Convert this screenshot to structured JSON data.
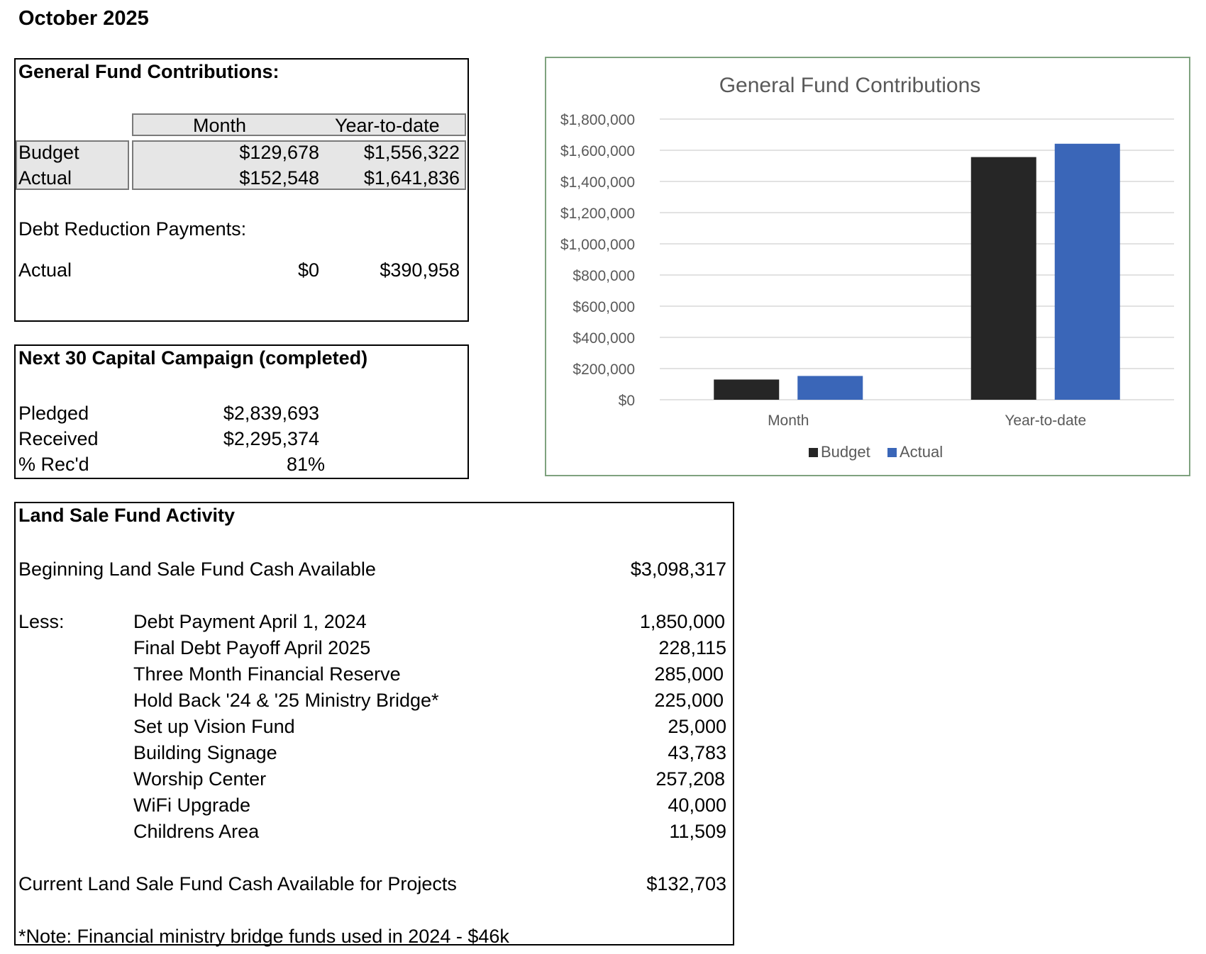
{
  "page_title": "October 2025",
  "general_fund": {
    "heading": "General Fund Contributions:",
    "col_month": "Month",
    "col_ytd": "Year-to-date",
    "rows": [
      {
        "label": "Budget",
        "month": "$129,678",
        "ytd": "$1,556,322"
      },
      {
        "label": "Actual",
        "month": "$152,548",
        "ytd": "$1,641,836"
      }
    ],
    "debt_heading": "Debt Reduction Payments:",
    "debt_label": "Actual",
    "debt_month": "$0",
    "debt_ytd": "$390,958"
  },
  "capital_campaign": {
    "heading": "Next 30 Capital Campaign (completed)",
    "rows": [
      {
        "label": "Pledged",
        "value": "$2,839,693"
      },
      {
        "label": "Received",
        "value": "$2,295,374"
      },
      {
        "label": "% Rec'd",
        "value": "81%"
      }
    ]
  },
  "land_sale": {
    "heading": "Land Sale Fund Activity",
    "beginning_label": "Beginning Land Sale Fund Cash Available",
    "beginning_value": "$3,098,317",
    "less_label": "Less:",
    "items": [
      {
        "label": "Debt Payment April 1, 2024",
        "value": "1,850,000"
      },
      {
        "label": "Final Debt Payoff April 2025",
        "value": "228,115"
      },
      {
        "label": "Three Month Financial Reserve",
        "value": "285,000"
      },
      {
        "label": "Hold Back '24 & '25 Ministry Bridge*",
        "value": "225,000"
      },
      {
        "label": "Set up Vision Fund",
        "value": "25,000"
      },
      {
        "label": "Building Signage",
        "value": "43,783"
      },
      {
        "label": "Worship Center",
        "value": "257,208"
      },
      {
        "label": "WiFi Upgrade",
        "value": "40,000"
      },
      {
        "label": "Childrens Area",
        "value": "11,509"
      }
    ],
    "current_label": "Current Land Sale Fund Cash Available for Projects",
    "current_value": "$132,703",
    "note": "*Note: Financial ministry bridge funds used in 2024 - $46k"
  },
  "chart_data": {
    "type": "bar",
    "title": "General Fund Contributions",
    "categories": [
      "Month",
      "Year-to-date"
    ],
    "series": [
      {
        "name": "Budget",
        "values": [
          129678,
          1556322
        ],
        "color": "#262626"
      },
      {
        "name": "Actual",
        "values": [
          152548,
          1641836
        ],
        "color": "#3a66b8"
      }
    ],
    "ylim": [
      0,
      1800000
    ],
    "yticks": [
      0,
      200000,
      400000,
      600000,
      800000,
      1000000,
      1200000,
      1400000,
      1600000,
      1800000
    ],
    "ytick_labels": [
      "$0",
      "$200,000",
      "$400,000",
      "$600,000",
      "$800,000",
      "$1,000,000",
      "$1,200,000",
      "$1,400,000",
      "$1,600,000",
      "$1,800,000"
    ],
    "grid": true,
    "legend": "bottom"
  }
}
